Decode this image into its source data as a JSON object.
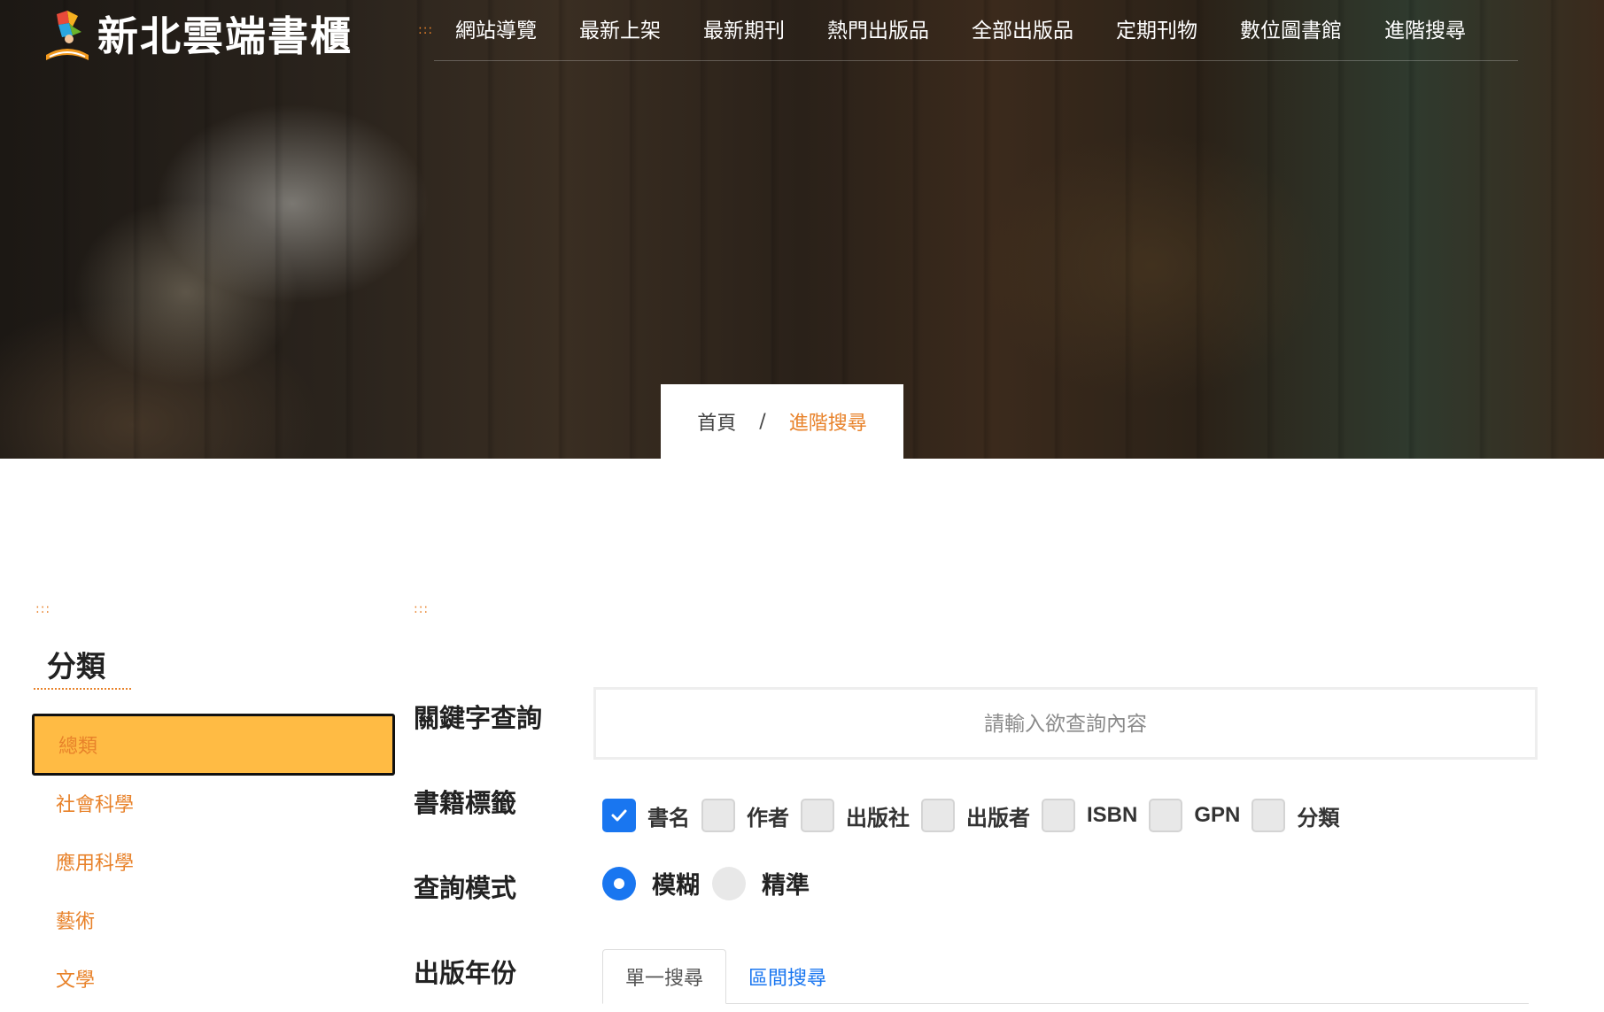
{
  "site": {
    "logo_text": "新北雲端書櫃",
    "nav_marker": ":::",
    "nav": [
      "網站導覽",
      "最新上架",
      "最新期刊",
      "熱門出版品",
      "全部出版品",
      "定期刊物",
      "數位圖書館",
      "進階搜尋"
    ]
  },
  "breadcrumb": {
    "home": "首頁",
    "separator": "/",
    "current": "進階搜尋"
  },
  "sidebar": {
    "marker": ":::",
    "title": "分類",
    "items": [
      {
        "label": "總類",
        "active": true
      },
      {
        "label": "社會科學",
        "active": false
      },
      {
        "label": "應用科學",
        "active": false
      },
      {
        "label": "藝術",
        "active": false
      },
      {
        "label": "文學",
        "active": false
      }
    ]
  },
  "search": {
    "marker": ":::",
    "keyword_label": "關鍵字查詢",
    "keyword_placeholder": "請輸入欲查詢內容",
    "keyword_value": "",
    "tags_label": "書籍標籤",
    "tags": [
      {
        "label": "書名",
        "checked": true
      },
      {
        "label": "作者",
        "checked": false
      },
      {
        "label": "出版社",
        "checked": false
      },
      {
        "label": "出版者",
        "checked": false
      },
      {
        "label": "ISBN",
        "checked": false
      },
      {
        "label": "GPN",
        "checked": false
      },
      {
        "label": "分類",
        "checked": false
      }
    ],
    "mode_label": "查詢模式",
    "modes": [
      {
        "label": "模糊",
        "checked": true
      },
      {
        "label": "精準",
        "checked": false
      }
    ],
    "year_label": "出版年份",
    "year_tabs": [
      {
        "label": "單一搜尋",
        "active": true
      },
      {
        "label": "區間搜尋",
        "active": false
      }
    ]
  },
  "colors": {
    "accent": "#e8822a",
    "active_category_bg": "#ffbb44",
    "checkbox_checked": "#1976f0"
  }
}
